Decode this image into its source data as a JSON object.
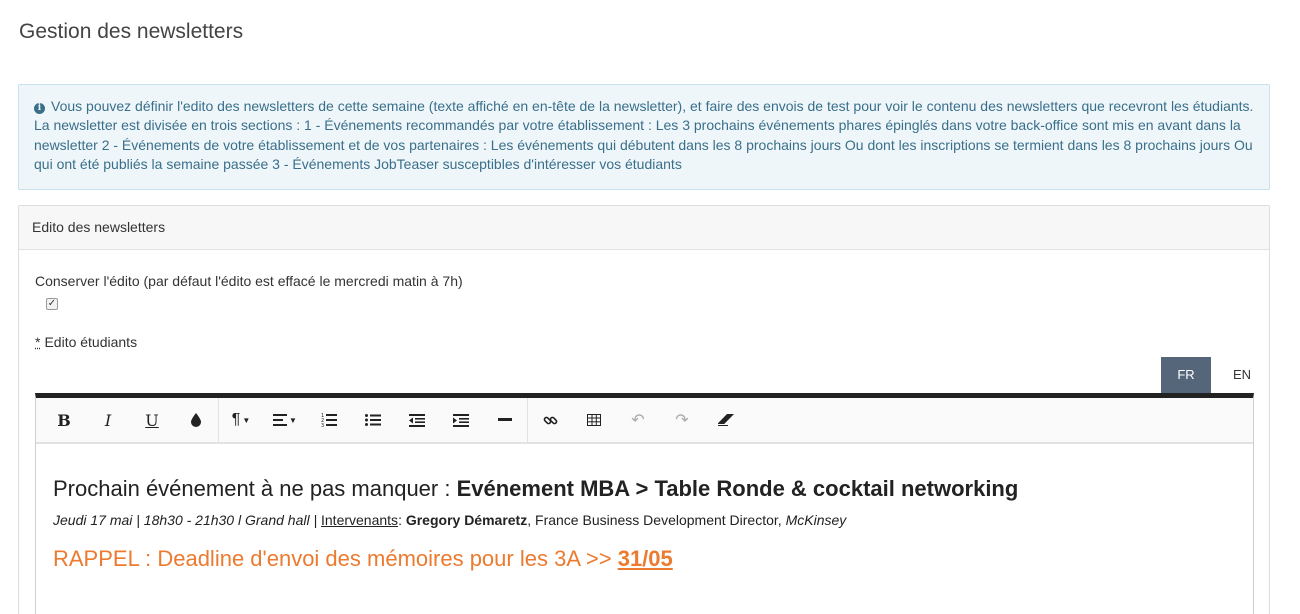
{
  "page": {
    "title": "Gestion des newsletters"
  },
  "info": {
    "icon": "info-icon",
    "text": "Vous pouvez définir l'edito des newsletters de cette semaine (texte affiché en en-tête de la newsletter), et faire des envois de test pour voir le contenu des newsletters que recevront les étudiants. La newsletter est divisée en trois sections : 1 - Événements recommandés par votre établissement : Les 3 prochains événements phares épinglés dans votre back-office sont mis en avant dans la newsletter 2 - Événements de votre établissement et de vos partenaires : Les événements qui débutent dans les 8 prochains jours Ou dont les inscriptions se termient dans les 8 prochains jours Ou qui ont été publiés la semaine passée 3 - Événements JobTeaser susceptibles d'intéresser vos étudiants"
  },
  "panel": {
    "heading": "Edito des newsletters",
    "keep_label": "Conserver l'édito (par défaut l'édito est effacé le mercredi matin à 7h)",
    "keep_checked": true,
    "edito_required_mark": "*",
    "edito_label": "Edito étudiants"
  },
  "lang_tabs": [
    {
      "label": "FR",
      "active": true
    },
    {
      "label": "EN",
      "active": false
    }
  ],
  "toolbar": [
    {
      "name": "bold",
      "glyph": "B"
    },
    {
      "name": "italic",
      "glyph": "I"
    },
    {
      "name": "underline",
      "glyph": "U"
    },
    {
      "name": "color",
      "glyph": "💧"
    },
    {
      "name": "paragraph",
      "glyph": "¶"
    },
    {
      "name": "align",
      "glyph": "≡"
    },
    {
      "name": "ordered-list",
      "glyph": "⒈"
    },
    {
      "name": "unordered-list",
      "glyph": "•≡"
    },
    {
      "name": "outdent",
      "glyph": "⇤"
    },
    {
      "name": "indent",
      "glyph": "⇥"
    },
    {
      "name": "horizontal-rule",
      "glyph": "—"
    },
    {
      "name": "link",
      "glyph": "🔗"
    },
    {
      "name": "table",
      "glyph": "▦"
    },
    {
      "name": "undo",
      "glyph": "↶"
    },
    {
      "name": "redo",
      "glyph": "↷"
    },
    {
      "name": "eraser",
      "glyph": "⌫"
    }
  ],
  "editor": {
    "headline_prefix": "Prochain événement à ne pas manquer : ",
    "headline_event": "Evénement MBA > Table Ronde & cocktail networking",
    "details_when": "Jeudi 17 mai | 18h30 - 21h30  l Grand hall | ",
    "details_speakers_label": "Intervenants",
    "details_colon": ": ",
    "details_speaker_name": "Gregory Démaretz",
    "details_speaker_role": ", France Business Development Director, ",
    "details_company": "McKinsey",
    "rappel_prefix": "RAPPEL : Deadline d'envoi des mémoires pour les 3A >> ",
    "rappel_date": "31/05"
  }
}
